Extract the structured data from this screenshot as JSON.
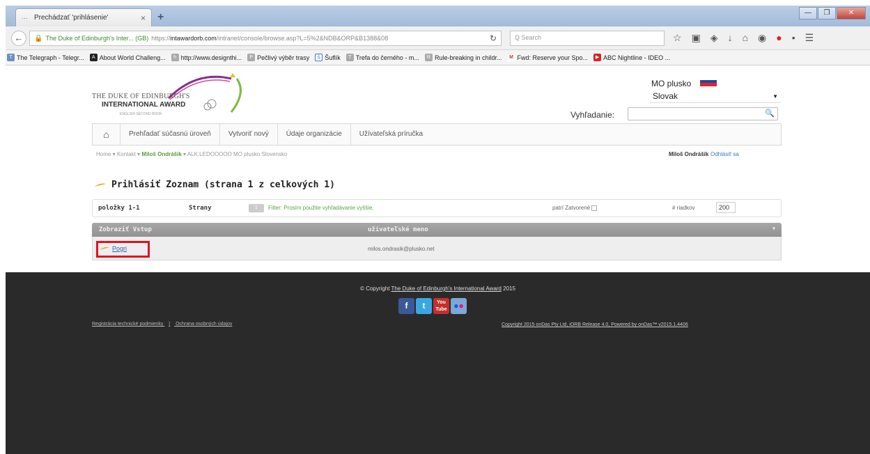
{
  "browser": {
    "tab_title": "Prechádzať 'prihlásenie'",
    "tab_close": "×",
    "new_tab": "+",
    "url_site": "The Duke of Edinburgh's Inter... (GB)",
    "url_prefix": "https://",
    "url_host": "intawardorb.com",
    "url_path": "/intranet/console/browse.asp?L=5%2&NDB&ORP&B1388&08",
    "search_placeholder": "Q Search",
    "window_min": "—",
    "window_max": "❐",
    "window_close": "✕"
  },
  "bookmarks": [
    {
      "label": "The Telegraph - Telegr...",
      "icon": "T"
    },
    {
      "label": "About World Challeng...",
      "icon": "A"
    },
    {
      "label": "http://www.designthi...",
      "icon": "h"
    },
    {
      "label": "Pečlivý výběr trasy",
      "icon": "P"
    },
    {
      "label": "Šuflík",
      "icon": "Š"
    },
    {
      "label": "Trefa do černého - m...",
      "icon": "T"
    },
    {
      "label": "Rule-breaking in childr...",
      "icon": "R"
    },
    {
      "label": "Fwd: Reserve your Spo...",
      "icon": "M"
    },
    {
      "label": "ABC Nightline - IDEO ...",
      "icon": "▶"
    }
  ],
  "header": {
    "logo_line1": "THE DUKE OF EDINBURGH'S",
    "logo_line2": "INTERNATIONAL AWARD",
    "logo_line3": "ENGLISH SECOND BOOK",
    "mo_label": "MO plusko",
    "language": "Slovak",
    "search_label": "Vyhľadanie:"
  },
  "menu": {
    "items": [
      "Prehľadať súčasnú úroveň",
      "Vytvoriť nový",
      "Údaje organizácie",
      "Užívateľská príručka"
    ]
  },
  "breadcrumb": {
    "home": "Home",
    "contact": "Kontakt",
    "person": "Miloš Ondrášik",
    "org": "ALK.LEDOOOOO MO plusko Slovensko",
    "user": "Miloš Ondrášik",
    "logout": "Odhlásiť sa"
  },
  "list": {
    "title": "Prihlásiť Zoznam (strana 1 z celkových 1)",
    "items_label": "položky 1-1",
    "pages_label": "Strany",
    "page_button": "1",
    "filter_text": "Filter: Prosím použite vyhľadávanie vyššie.",
    "closed_label": "patrí Zatvorené",
    "rows_label": "# riadkov",
    "rows_value": "200",
    "col_view": "Zobraziť Vstup",
    "col_username": "užívateľské meno",
    "col_menu": "▾",
    "row_login": "Pogri",
    "row_email": "milos.ondrasik@plusko.net"
  },
  "footer": {
    "copyright_prefix": "© Copyright",
    "copyright_link": "The Duke of Edinburgh's International Award",
    "copyright_year": "2015",
    "link_terms": "Registrácia technické podmienky",
    "link_sep": "|",
    "link_privacy": "Ochrana osobných údajov",
    "powered": "Copyright 2015 onDas Pty Ltd, iORB Release 4.0, Powered by onDas™ v2015.1.4406"
  },
  "colors": {
    "accent_green": "#5aa24a",
    "link_blue": "#2e63b6",
    "highlight_red": "#e0141e",
    "footer_bg": "#2a2a2a"
  }
}
